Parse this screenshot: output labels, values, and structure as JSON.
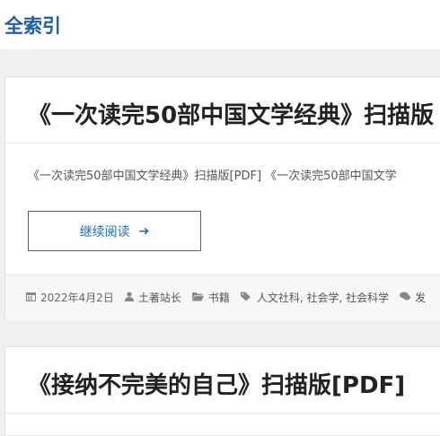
{
  "site": {
    "title": "全索引"
  },
  "posts": [
    {
      "title": "《一次读完50部中国文学经典》扫描版",
      "excerpt": "《一次读完50部中国文学经典》扫描版[PDF] 《一次读完50部中国文学",
      "read_more": "继续阅读",
      "meta": {
        "date": "2022年4月2日",
        "author": "土著站长",
        "category": "书籍",
        "tags": "人文社科, 社会学, 社会科学",
        "comments": "发"
      }
    },
    {
      "title": "《接纳不完美的自己》扫描版[PDF]"
    }
  ],
  "icons": {
    "calendar": "calendar-icon",
    "user": "user-icon",
    "folder": "folder-icon",
    "tag": "tag-icon",
    "comment": "comment-icon",
    "arrow": "arrow-right-icon"
  },
  "colors": {
    "brand": "#1e5da8",
    "button_border": "#1e6fa8",
    "background": "#f0f0f0"
  }
}
